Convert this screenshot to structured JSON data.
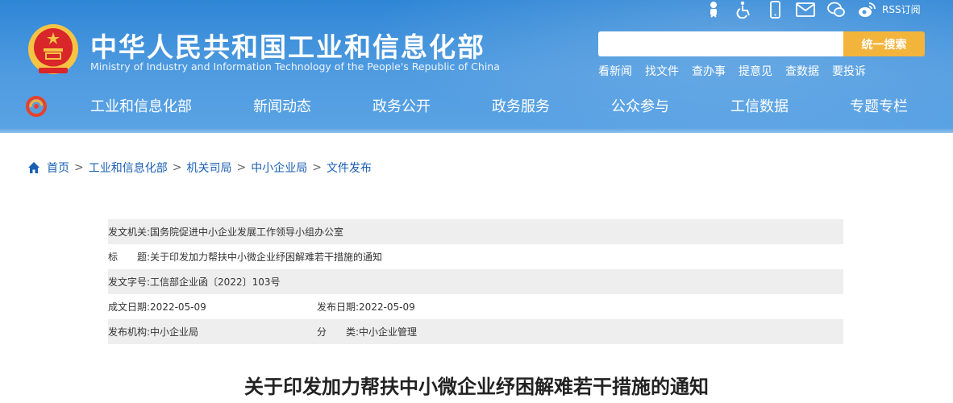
{
  "header": {
    "site_title": "中华人民共和国工业和信息化部",
    "site_subtitle": "Ministry of Industry and Information Technology of the People's Republic of China",
    "top_icons": [
      "elderly-mode-icon",
      "accessibility-icon",
      "mobile-icon",
      "mail-icon",
      "wechat-icon",
      "weibo-icon"
    ],
    "rss_label": "RSS订阅",
    "search": {
      "placeholder": "",
      "button_label": "统一搜索"
    },
    "quick_links": [
      "看新闻",
      "找文件",
      "查办事",
      "提意见",
      "查数据",
      "要投诉"
    ],
    "nav": [
      "工业和信息化部",
      "新闻动态",
      "政务公开",
      "政务服务",
      "公众参与",
      "工信数据",
      "专题专栏"
    ]
  },
  "breadcrumb": [
    "首页",
    "工业和信息化部",
    "机关司局",
    "中小企业局",
    "文件发布"
  ],
  "meta": {
    "issuer_label": "发文机关:",
    "issuer": "国务院促进中小企业发展工作领导小组办公室",
    "title_label": "标　　题:",
    "title": "关于印发加力帮扶中小微企业纾困解难若干措施的通知",
    "doc_no_label": "发文字号:",
    "doc_no": "工信部企业函〔2022〕103号",
    "created_label": "成文日期:",
    "created": "2022-05-09",
    "published_label": "发布日期:",
    "published": "2022-05-09",
    "org_label": "发布机构:",
    "org": "中小企业局",
    "category_label": "分　　类:",
    "category": "中小企业管理"
  },
  "document": {
    "title": "关于印发加力帮扶中小微企业纾困解难若干措施的通知"
  },
  "colors": {
    "header_blue": "#2f86d6",
    "search_button": "#f3b43c",
    "link_blue": "#1a5fb4",
    "row_shade": "#eeeeee"
  }
}
